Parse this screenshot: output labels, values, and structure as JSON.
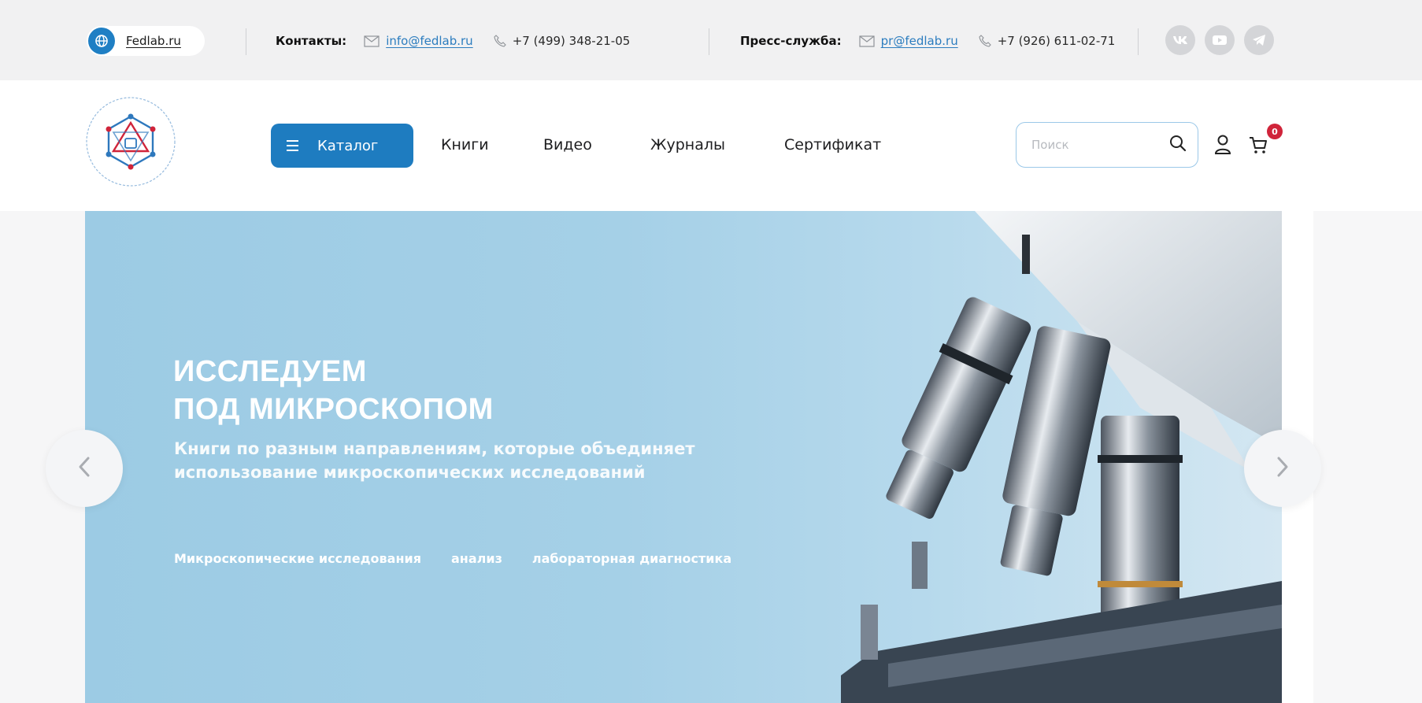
{
  "topbar": {
    "site_link": "Fedlab.ru",
    "contacts_label": "Контакты:",
    "contacts_email": "info@fedlab.ru",
    "contacts_phone": "+7 (499) 348-21-05",
    "press_label": "Пресс-служба:",
    "press_email": "pr@fedlab.ru",
    "press_phone": "+7 (926) 611-02-71",
    "socials": [
      "vk-icon",
      "youtube-icon",
      "telegram-icon"
    ]
  },
  "header": {
    "catalog_label": "Каталог",
    "nav": [
      "Книги",
      "Видео",
      "Журналы",
      "Сертификат"
    ],
    "search_placeholder": "Поиск",
    "cart_count": "0"
  },
  "hero": {
    "title_line1": "ИССЛЕДУЕМ",
    "title_line2": "ПОД МИКРОСКОПОМ",
    "subtitle_line1": "Книги по разным направлениям, которые объединяет",
    "subtitle_line2": "использование микроскопических исследований",
    "tags": [
      "Микроскопические исследования",
      "анализ",
      "лабораторная диагностика"
    ]
  },
  "colors": {
    "accent": "#1e7cc0",
    "topbar_bg": "#f1f1f2",
    "badge": "#d0243a",
    "logo_blue": "#2e78bd",
    "logo_red": "#d0243a",
    "hero_bg": "#a5d0e7"
  }
}
